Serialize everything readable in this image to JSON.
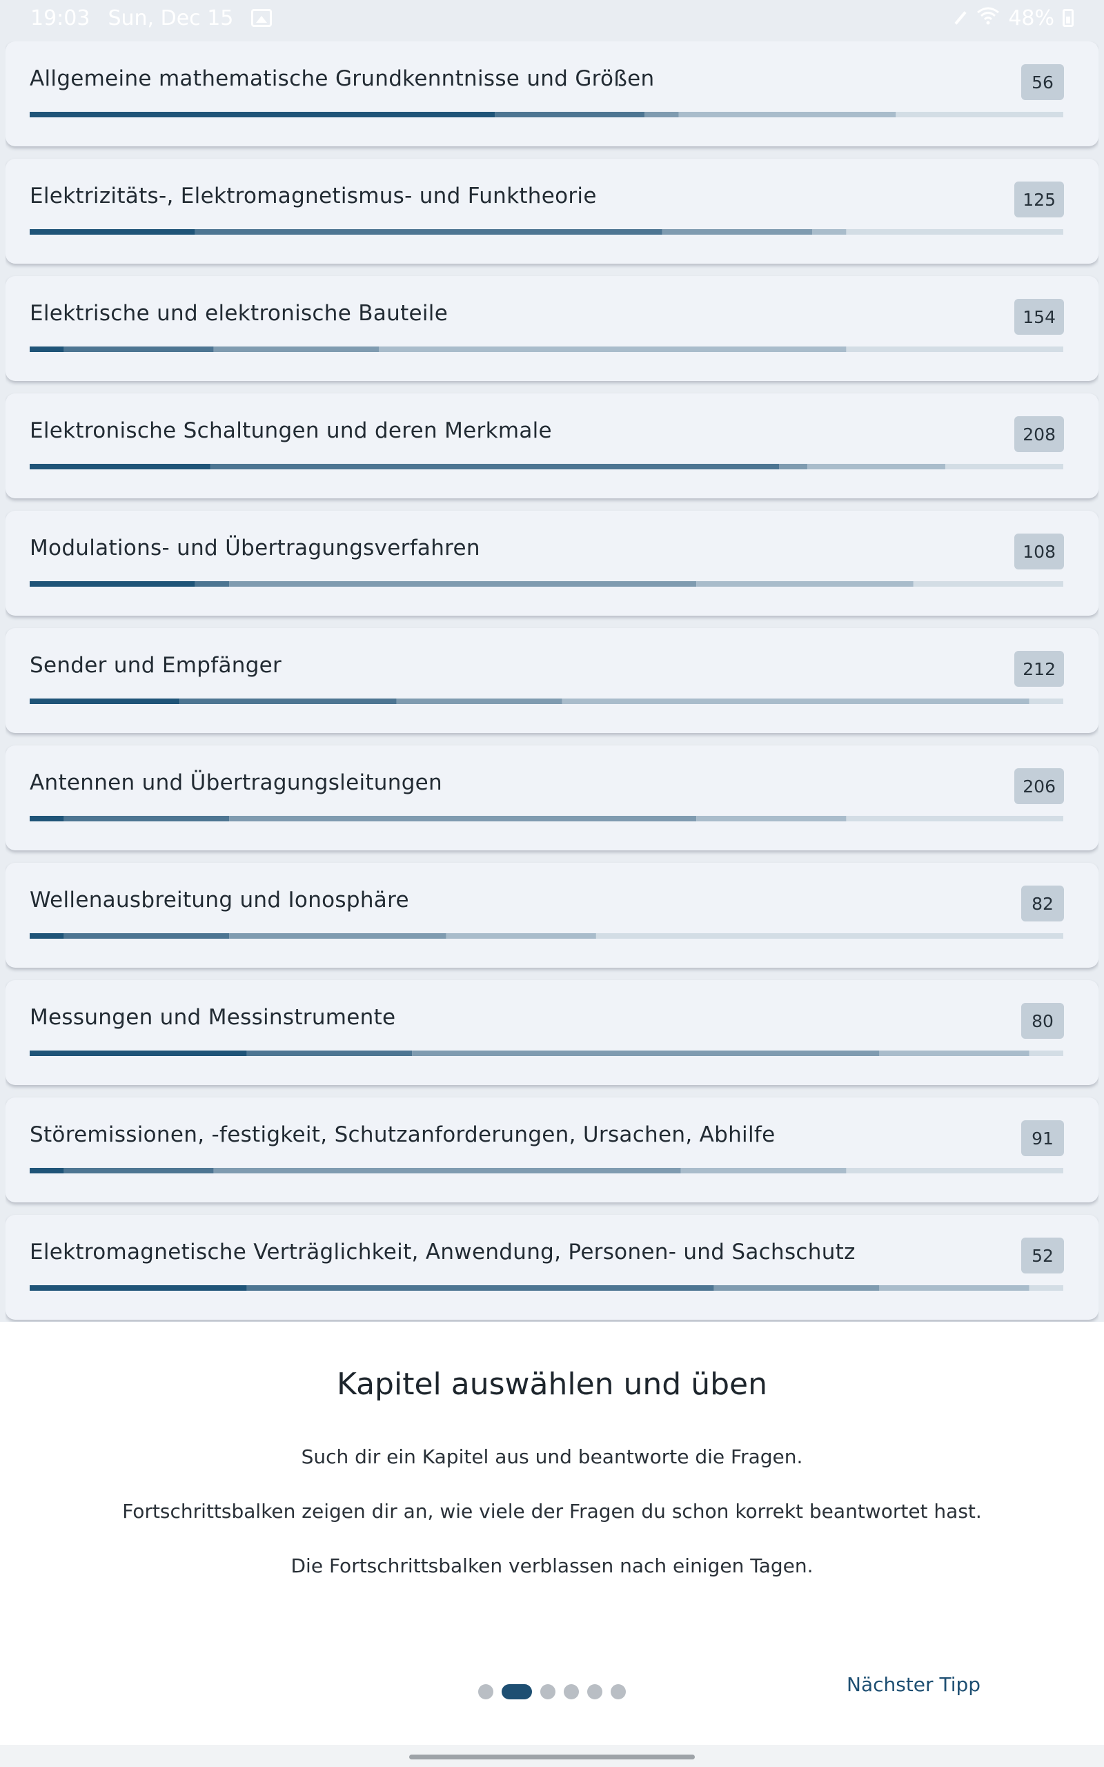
{
  "status_bar": {
    "time": "19:03",
    "date": "Sun, Dec 15",
    "battery": "48%"
  },
  "colors": {
    "bar_segments": [
      "#1f5478",
      "#4d7592",
      "#7f9bb0",
      "#a9bccb",
      "#d3dde5"
    ],
    "accent": "#1e4f72",
    "badge_bg": "#c3ced8"
  },
  "chapters": [
    {
      "title": "Allgemeine mathematische Grundkenntnisse und Größen",
      "count": "56",
      "progress": [
        45,
        14.5,
        3.3,
        21,
        16.2
      ]
    },
    {
      "title": "Elektrizitäts-, Elektromagnetismus- und Funktheorie",
      "count": "125",
      "progress": [
        16,
        45.2,
        14.5,
        3.3,
        21
      ]
    },
    {
      "title": "Elektrische und elektronische Bauteile",
      "count": "154",
      "progress": [
        3.3,
        14.5,
        16,
        45.2,
        21
      ]
    },
    {
      "title": "Elektronische Schaltungen und deren Merkmale",
      "count": "208",
      "progress": [
        21,
        66,
        3.3,
        16,
        13.7
      ]
    },
    {
      "title": "Modulations- und Übertragungsverfahren",
      "count": "108",
      "progress": [
        16,
        3.3,
        45.2,
        21,
        14.5
      ]
    },
    {
      "title": "Sender und Empfänger",
      "count": "212",
      "progress": [
        14.5,
        21,
        16,
        45.2,
        3.3
      ]
    },
    {
      "title": "Antennen und Übertragungsleitungen",
      "count": "206",
      "progress": [
        3.3,
        16,
        45.2,
        14.5,
        21
      ]
    },
    {
      "title": "Wellenausbreitung und Ionosphäre",
      "count": "82",
      "progress": [
        3.3,
        16,
        21,
        14.5,
        45.2
      ]
    },
    {
      "title": "Messungen und Messinstrumente",
      "count": "80",
      "progress": [
        21,
        16,
        45.2,
        14.5,
        3.3
      ]
    },
    {
      "title": "Störemissionen, -festigkeit, Schutzanforderungen, Ursachen, Abhilfe",
      "count": "91",
      "progress": [
        3.3,
        14.5,
        45.2,
        16,
        21
      ]
    },
    {
      "title": "Elektromagnetische Verträglichkeit, Anwendung, Personen- und Sachschutz",
      "count": "52",
      "progress": [
        21,
        45.2,
        16,
        14.5,
        3.3
      ]
    }
  ],
  "tip": {
    "title": "Kapitel auswählen und üben",
    "lines": [
      "Such dir ein Kapitel aus und beantworte die Fragen.",
      "Fortschrittsbalken zeigen dir an, wie viele der Fragen du schon korrekt beantwortet hast.",
      "Die Fortschrittsbalken verblassen nach einigen Tagen."
    ],
    "pager": {
      "total": 6,
      "active": 2
    },
    "next_label": "Nächster Tipp"
  }
}
